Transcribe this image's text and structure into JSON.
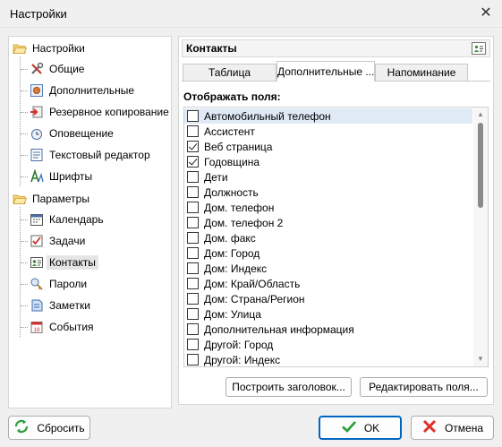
{
  "window": {
    "title": "Настройки"
  },
  "tree": {
    "groups": [
      {
        "label": "Настройки",
        "items": [
          {
            "label": "Общие",
            "icon": "tools-icon"
          },
          {
            "label": "Дополнительные",
            "icon": "advanced-settings-icon"
          },
          {
            "label": "Резервное копирование",
            "icon": "backup-icon"
          },
          {
            "label": "Оповещение",
            "icon": "alarm-clock-icon"
          },
          {
            "label": "Текстовый редактор",
            "icon": "text-editor-icon"
          },
          {
            "label": "Шрифты",
            "icon": "fonts-icon"
          }
        ]
      },
      {
        "label": "Параметры",
        "items": [
          {
            "label": "Календарь",
            "icon": "calendar-icon"
          },
          {
            "label": "Задачи",
            "icon": "tasks-icon"
          },
          {
            "label": "Контакты",
            "icon": "contacts-icon",
            "selected": true
          },
          {
            "label": "Пароли",
            "icon": "passwords-icon"
          },
          {
            "label": "Заметки",
            "icon": "notes-icon"
          },
          {
            "label": "События",
            "icon": "events-icon"
          }
        ]
      }
    ]
  },
  "panel": {
    "title": "Контакты",
    "tabs": [
      "Таблица",
      "Дополнительные ...",
      "Напоминание"
    ],
    "active_tab": 1,
    "section_label": "Отображать поля:",
    "fields": [
      {
        "label": "Автомобильный телефон",
        "checked": false
      },
      {
        "label": "Ассистент",
        "checked": false
      },
      {
        "label": "Веб страница",
        "checked": true
      },
      {
        "label": "Годовщина",
        "checked": true
      },
      {
        "label": "Дети",
        "checked": false
      },
      {
        "label": "Должность",
        "checked": false
      },
      {
        "label": "Дом. телефон",
        "checked": false
      },
      {
        "label": "Дом. телефон 2",
        "checked": false
      },
      {
        "label": "Дом. факс",
        "checked": false
      },
      {
        "label": "Дом: Город",
        "checked": false
      },
      {
        "label": "Дом: Индекс",
        "checked": false
      },
      {
        "label": "Дом: Край/Область",
        "checked": false
      },
      {
        "label": "Дом: Страна/Регион",
        "checked": false
      },
      {
        "label": "Дом: Улица",
        "checked": false
      },
      {
        "label": "Дополнительная информация",
        "checked": false
      },
      {
        "label": "Другой: Город",
        "checked": false
      },
      {
        "label": "Другой: Индекс",
        "checked": false
      }
    ],
    "build_header_label": "Построить заголовок...",
    "edit_fields_label": "Редактировать поля..."
  },
  "footer": {
    "reset_label": "Сбросить",
    "ok_label": "OK",
    "cancel_label": "Отмена"
  }
}
